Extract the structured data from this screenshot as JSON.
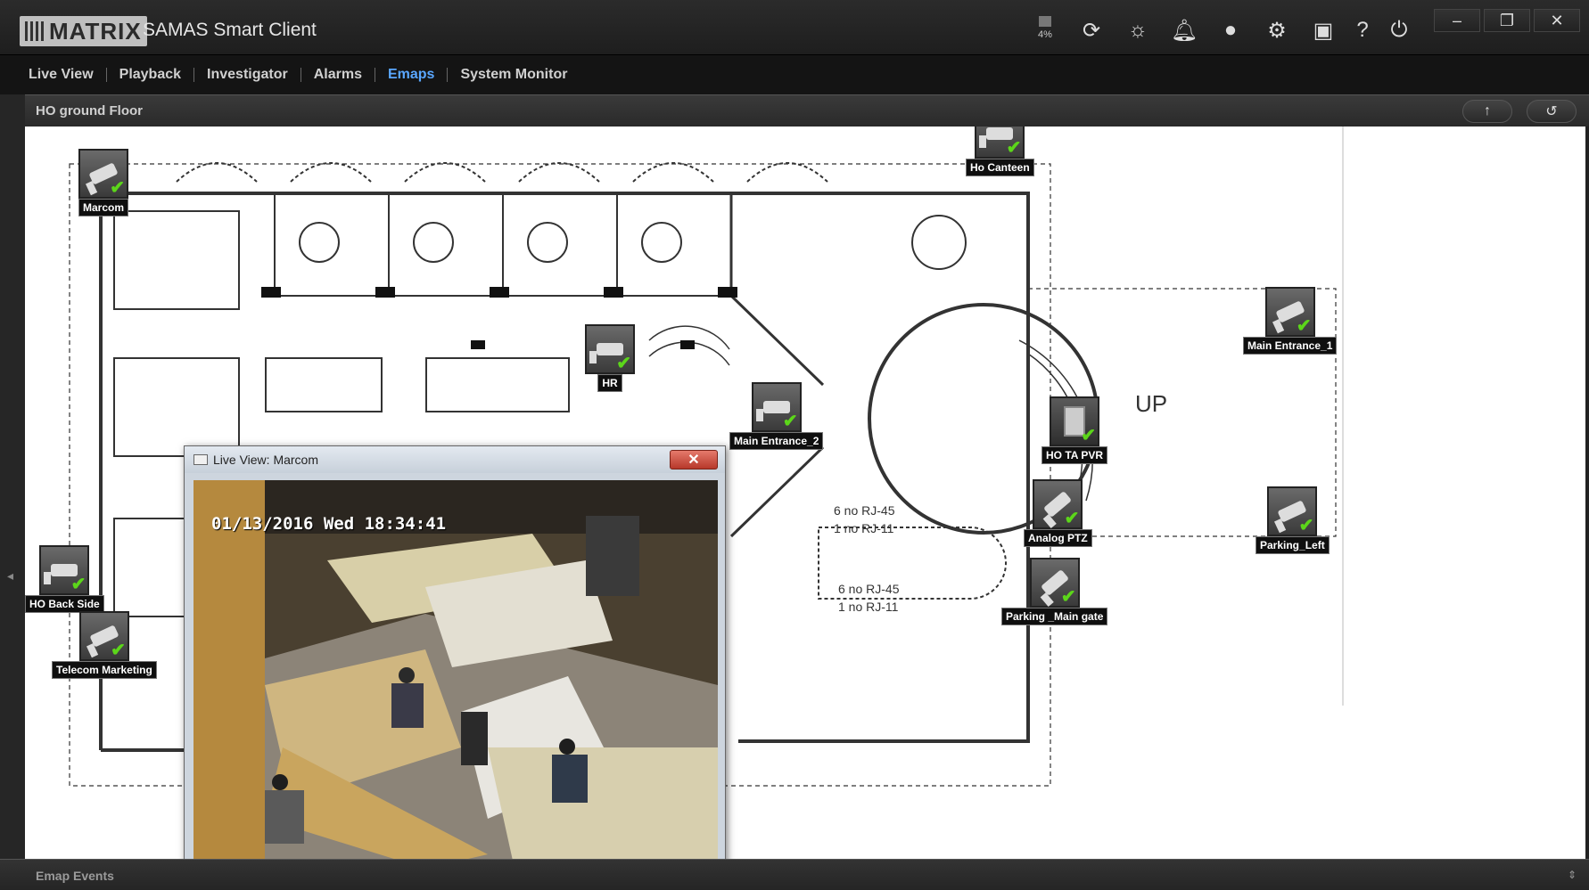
{
  "app": {
    "logo_text": "MATRIX",
    "title": "SAMAS Smart Client"
  },
  "toolbar": {
    "cpu_label": "4%",
    "icons": [
      "refresh-icon",
      "alarm-light-icon",
      "bell-icon",
      "globe-icon",
      "gear-icon",
      "monitor-settings-icon",
      "help-icon",
      "power-icon"
    ]
  },
  "window": {
    "minimize": "–",
    "restore": "❐",
    "close": "✕"
  },
  "menu": {
    "items": [
      "Live View",
      "Playback",
      "Investigator",
      "Alarms",
      "Emaps",
      "System Monitor"
    ],
    "active": "Emaps"
  },
  "page": {
    "title": "HO ground Floor",
    "up_button": "↑",
    "back_button": "↺"
  },
  "map": {
    "up_label": "UP",
    "jack_notes": [
      {
        "line1": "6 no RJ-45",
        "line2": "1 no RJ-11"
      },
      {
        "line1": "6 no RJ-45",
        "line2": "1 no RJ-11"
      }
    ]
  },
  "cameras": [
    {
      "label": "Marcom",
      "type": "bullet"
    },
    {
      "label": "Ho Canteen",
      "type": "dome"
    },
    {
      "label": "HR",
      "type": "dome"
    },
    {
      "label": "Main Entrance_2",
      "type": "dome"
    },
    {
      "label": "Main Entrance_1",
      "type": "bullet"
    },
    {
      "label": "HO TA PVR",
      "type": "pvr"
    },
    {
      "label": "Analog PTZ",
      "type": "ptz"
    },
    {
      "label": "Parking_Left",
      "type": "bullet"
    },
    {
      "label": "Parking _Main gate",
      "type": "ptz"
    },
    {
      "label": "HO Back Side",
      "type": "bullet"
    },
    {
      "label": "Telecom Marketing",
      "type": "bullet"
    }
  ],
  "liveview": {
    "title": "Live View: Marcom",
    "close_label": "✕",
    "osd": "01/13/2016 Wed 18:34:41"
  },
  "bottom": {
    "title": "Emap Events",
    "expand": "⇕"
  },
  "colors": {
    "accent": "#5aa7ff",
    "status_ok": "#5cd61a",
    "close_red": "#c0392b"
  }
}
